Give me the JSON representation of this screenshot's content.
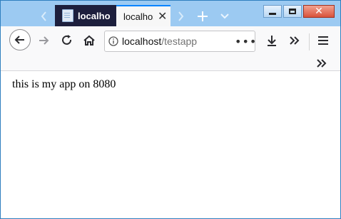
{
  "tabs": [
    {
      "label": "localhost",
      "active": false
    },
    {
      "label": "localhost",
      "active": true
    }
  ],
  "icons": {
    "tabs_left": "chevron-left-icon",
    "tabs_right": "chevron-right-icon",
    "new_tab": "plus-icon",
    "tab_list": "chevron-down-icon",
    "back": "back-arrow-icon",
    "forward": "forward-arrow-icon",
    "reload": "reload-icon",
    "home": "home-icon",
    "info": "info-icon",
    "page_actions": "ellipsis-icon",
    "downloads": "download-icon",
    "overflow": "double-chevron-icon",
    "menu": "hamburger-icon",
    "bookmarks_overflow": "double-chevron-icon"
  },
  "urlbar": {
    "host": "localhost",
    "path": "/testapp"
  },
  "page": {
    "text": "this is my app on 8080"
  },
  "colors": {
    "titlebar": "#9ccaf2",
    "inactive_tab": "#1d1f3d",
    "active_tab_accent": "#0a84ff",
    "toolbar": "#f9f9fa",
    "close_button": "#d9533c"
  }
}
